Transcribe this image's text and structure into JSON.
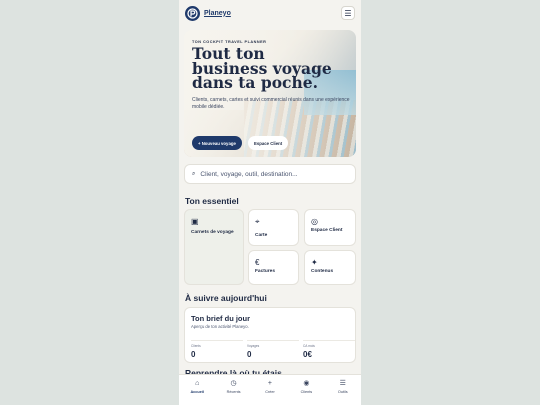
{
  "app": {
    "brand": "Planeyo",
    "menu_icon": "☰"
  },
  "hero": {
    "eyebrow": "TON COCKPIT TRAVEL PLANNER",
    "title": "Tout ton business voyage dans ta poche.",
    "subtitle": "Clients, carnets, cartes et suivi commercial réunis dans une expérience mobile dédiée.",
    "primary_cta": "+ Nouveau voyage",
    "secondary_cta": "Espace Client"
  },
  "search": {
    "icon": "⌕",
    "placeholder": "Client, voyage, outil, destination..."
  },
  "essentials": {
    "title": "Ton essentiel",
    "tiles": [
      {
        "icon": "▣",
        "label": "Carnets de voyage"
      },
      {
        "icon": "⌖",
        "label": "Carte"
      },
      {
        "icon": "◎",
        "label": "Espace Client"
      },
      {
        "icon": "€",
        "label": "Factures"
      },
      {
        "icon": "✦",
        "label": "Contenus"
      }
    ]
  },
  "today": {
    "title": "À suivre aujourd'hui",
    "brief_title": "Ton brief du jour",
    "brief_sub": "Aperçu de ton activité Planeyo.",
    "stats": [
      {
        "label": "Clients",
        "value": "0"
      },
      {
        "label": "Voyages",
        "value": "0"
      },
      {
        "label": "CA mois",
        "value": "0€"
      }
    ]
  },
  "resume": {
    "title": "Reprendre là où tu étais"
  },
  "tabs": [
    {
      "icon": "⌂",
      "label": "Accueil"
    },
    {
      "icon": "◷",
      "label": "Récents"
    },
    {
      "icon": "+",
      "label": "Créer"
    },
    {
      "icon": "◉",
      "label": "Clients"
    },
    {
      "icon": "☰",
      "label": "Outils"
    }
  ],
  "colors": {
    "accent": "#1f3a6b",
    "background": "#f4f3ef",
    "text": "#1f2a44"
  }
}
